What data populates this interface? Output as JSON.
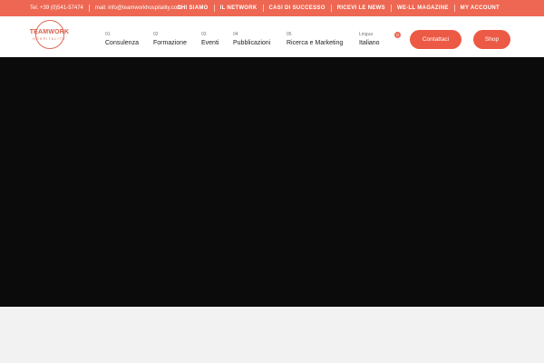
{
  "topbar": {
    "phone": "Tel. +39 (0)541-57474",
    "email": "mail: info@teamworkhospitality.com",
    "links": [
      "CHI SIAMO",
      "IL NETWORK",
      "CASI DI SUCCESSO",
      "RICEVI LE NEWS",
      "WE-LL MAGAZINE",
      "MY ACCOUNT"
    ]
  },
  "logo": {
    "line1": "TEAMWORK",
    "line2": "HOSPITALITY"
  },
  "menu": [
    {
      "num": "01",
      "label": "Consulenza"
    },
    {
      "num": "02",
      "label": "Formazione"
    },
    {
      "num": "03",
      "label": "Eventi"
    },
    {
      "num": "04",
      "label": "Pubblicazioni"
    },
    {
      "num": "05",
      "label": "Ricerca e Marketing"
    }
  ],
  "language": {
    "caption": "Lingua",
    "value": "Italiano"
  },
  "cart": {
    "count": "0"
  },
  "buttons": {
    "contact": "Contattaci",
    "shop": "Shop"
  },
  "colors": {
    "accent": "#ee6752",
    "hero": "#0b0b0b"
  }
}
